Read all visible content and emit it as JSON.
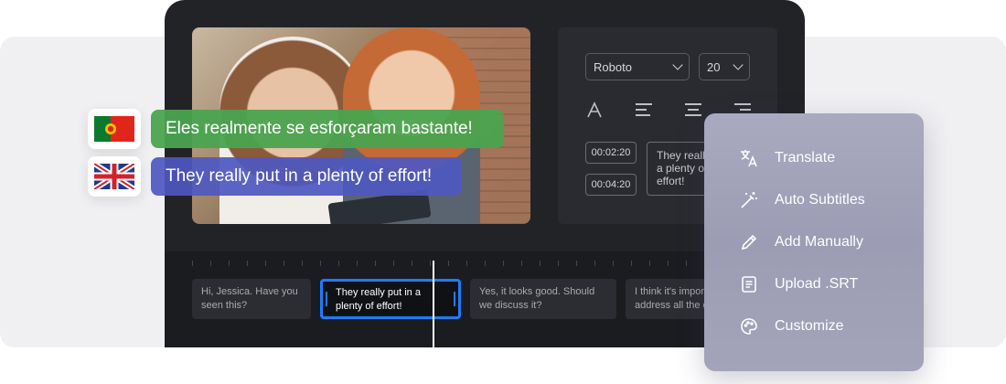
{
  "captions": {
    "portuguese": "Eles realmente se esforçaram bastante!",
    "english": "They really put in a plenty of effort!"
  },
  "flags": {
    "portugal": "portugal-flag-icon",
    "uk": "uk-flag-icon"
  },
  "props": {
    "font": "Roboto",
    "size": "20",
    "times": [
      "00:02:20",
      "00:04:20"
    ],
    "subtitle_text": [
      "They really put in",
      "a plenty of",
      "effort!"
    ]
  },
  "timeline": {
    "clips": [
      {
        "text": "Hi, Jessica. Have you seen this?"
      },
      {
        "text": "They really put in a plenty of effort!"
      },
      {
        "text": "Yes, it looks good. Should we discuss it?"
      },
      {
        "text": "I think it's important to address all the details."
      }
    ]
  },
  "menu": {
    "items": [
      {
        "label": "Translate",
        "icon": "translate-icon"
      },
      {
        "label": "Auto Subtitles",
        "icon": "magic-wand-icon"
      },
      {
        "label": "Add Manually",
        "icon": "pencil-icon"
      },
      {
        "label": "Upload .SRT",
        "icon": "document-icon"
      },
      {
        "label": "Customize",
        "icon": "palette-icon"
      }
    ]
  },
  "colors": {
    "accent": "#1e7cff",
    "caption_pt": "#4aa44f",
    "caption_en": "#4e58c0"
  }
}
